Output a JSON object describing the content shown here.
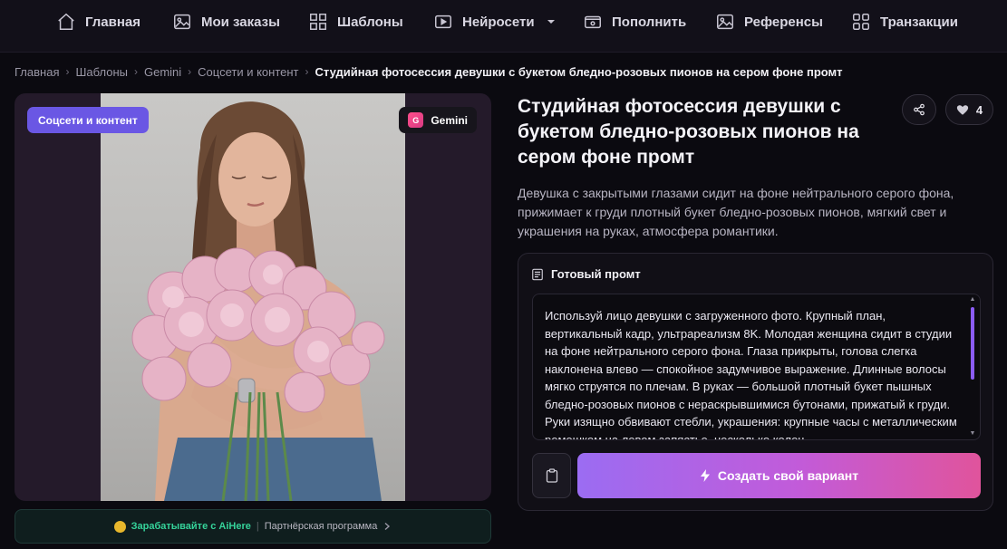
{
  "nav": {
    "items": [
      {
        "label": "Главная",
        "icon": "home-icon"
      },
      {
        "label": "Мои заказы",
        "icon": "image-icon"
      },
      {
        "label": "Шаблоны",
        "icon": "grid-icon"
      },
      {
        "label": "Нейросети",
        "icon": "play-icon"
      },
      {
        "label": "Пополнить",
        "icon": "wallet-icon"
      },
      {
        "label": "Референсы",
        "icon": "photo-icon"
      },
      {
        "label": "Транзакции",
        "icon": "grid-icon"
      }
    ]
  },
  "breadcrumb": {
    "items": [
      "Главная",
      "Шаблоны",
      "Gemini",
      "Соцсети и контент"
    ],
    "current": "Студийная фотосессия девушки с букетом бледно-розовых пионов на сером фоне промт"
  },
  "image_card": {
    "category_tag": "Соцсети и контент",
    "model_badge": "G",
    "model_tag": "Gemini"
  },
  "affiliate": {
    "earn_label": "Зарабатывайте с AiHere",
    "program_label": "Партнёрская программа"
  },
  "detail": {
    "title": "Студийная фотосессия девушки с букетом бледно-розовых пионов на сером фоне промт",
    "likes": "4",
    "description": "Девушка с закрытыми глазами сидит на фоне нейтрального серого фона, прижимает к груди плотный букет бледно-розовых пионов, мягкий свет и украшения на руках, атмосфера романтики."
  },
  "prompt": {
    "heading": "Готовый промт",
    "text": "Используй лицо девушки с загруженного фото. Крупный план, вертикальный кадр, ультрареализм 8K. Молодая женщина сидит в студии на фоне нейтрального серого фона. Глаза прикрыты, голова слегка наклонена влево — спокойное задумчивое выражение. Длинные волосы мягко струятся по плечам. В руках — большой плотный букет пышных бледно-розовых пионов с нераскрывшимися бутонами, прижатый к груди. Руки изящно обвивают стебли, украшения: крупные часы с металлическим ремешком на левом запястье, несколько колец",
    "create_label": "Создать свой вариант"
  },
  "colors": {
    "accent": "#6a57e4",
    "scroll": "#8b5cf6",
    "affiliate": "#35d39a"
  }
}
